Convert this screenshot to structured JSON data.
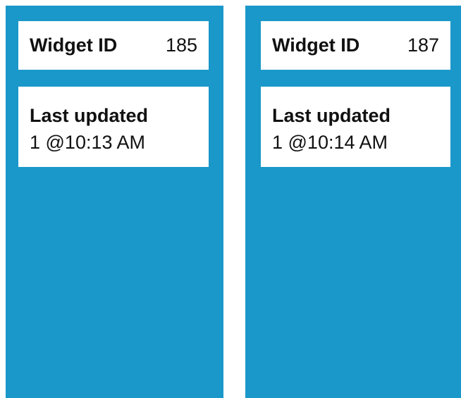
{
  "widgets": [
    {
      "id_label": "Widget ID",
      "id_value": "185",
      "updated_label": "Last updated",
      "updated_value": "1 @10:13 AM"
    },
    {
      "id_label": "Widget ID",
      "id_value": "187",
      "updated_label": "Last updated",
      "updated_value": "1 @10:14 AM"
    }
  ],
  "colors": {
    "widget_background": "#1a98c9",
    "card_background": "#ffffff",
    "text": "#111111"
  }
}
